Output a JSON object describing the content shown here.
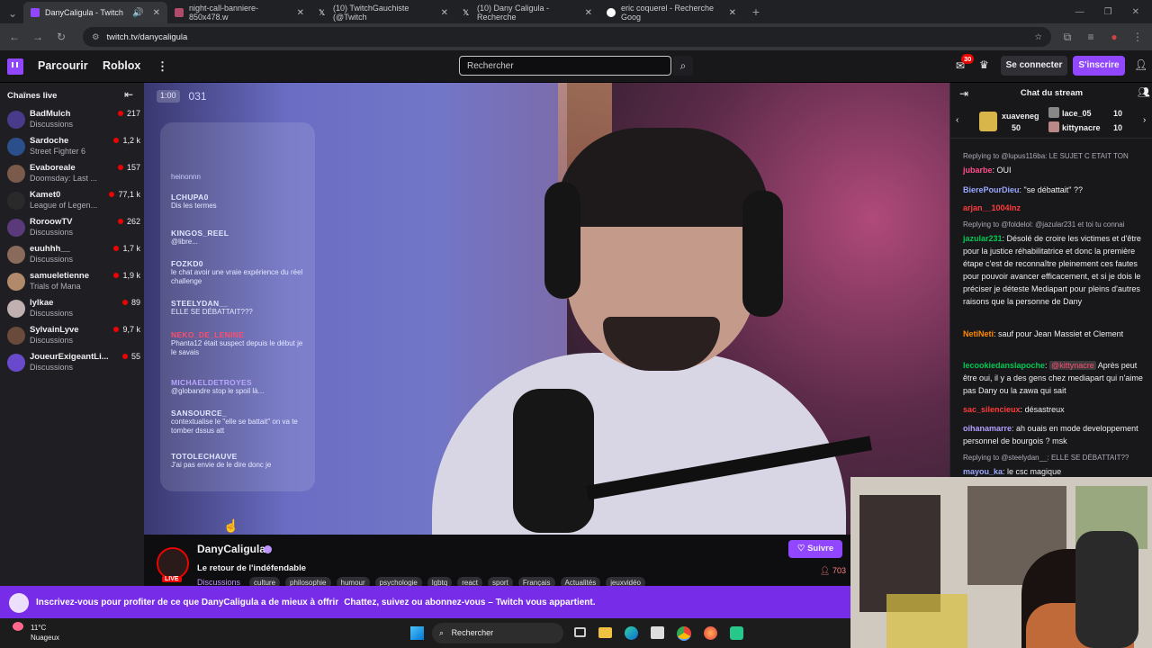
{
  "browser": {
    "tabs": [
      {
        "title": "DanyCaligula - Twitch",
        "active": true
      },
      {
        "title": "night-call-banniere-850x478.w"
      },
      {
        "title": "(10) TwitchGauchiste (@Twitch"
      },
      {
        "title": "(10) Dany Caligula - Recherche"
      },
      {
        "title": "eric coquerel - Recherche Goog"
      }
    ],
    "url": "twitch.tv/danycaligula"
  },
  "topnav": {
    "browse": "Parcourir",
    "roblox": "Roblox",
    "search_placeholder": "Rechercher",
    "notif_count": "30",
    "login": "Se connecter",
    "signup": "S'inscrire"
  },
  "sidebar": {
    "title": "Chaînes live",
    "channels": [
      {
        "name": "BadMulch",
        "category": "Discussions",
        "viewers": "217",
        "color": "#4a3a8a"
      },
      {
        "name": "Sardoche",
        "category": "Street Fighter 6",
        "viewers": "1,2 k",
        "color": "#2b4f8a"
      },
      {
        "name": "Evaboreale",
        "category": "Doomsday: Last ...",
        "viewers": "157",
        "color": "#7a5a4a"
      },
      {
        "name": "Kamet0",
        "category": "League of Legen...",
        "viewers": "77,1 k",
        "color": "#2a2a2a"
      },
      {
        "name": "RoroowTV",
        "category": "Discussions",
        "viewers": "262",
        "color": "#5a3a7a"
      },
      {
        "name": "euuhhh__",
        "category": "Discussions",
        "viewers": "1,7 k",
        "color": "#8a6a5a"
      },
      {
        "name": "samueletienne",
        "category": "Trials of Mana",
        "viewers": "1,9 k",
        "color": "#b08a6a"
      },
      {
        "name": "lylkae",
        "category": "Discussions",
        "viewers": "89",
        "color": "#c0b0b0"
      },
      {
        "name": "SylvainLyve",
        "category": "Discussions",
        "viewers": "9,7 k",
        "color": "#6a4a3a"
      },
      {
        "name": "JoueurExigeantLi...",
        "category": "Discussions",
        "viewers": "55",
        "color": "#6a4acc"
      }
    ]
  },
  "overlay_chat": [
    {
      "user": "LCHUPA0",
      "text": "Dis les termes",
      "color": "#dfe6ff"
    },
    {
      "user": "KINGOS_REEL",
      "text": "@libre...",
      "color": "#dfe6ff"
    },
    {
      "user": "FOZKD0",
      "text": "le chat avoir une vraie expérience du réel challenge",
      "color": "#dfe6ff"
    },
    {
      "user": "STEELYDAN__",
      "text": "ELLE SE DÉBATTAIT???",
      "color": "#dfe6ff"
    },
    {
      "user": "NEKO_DE_LENINE",
      "text": "Phanta12 était suspect depuis le début je le savais",
      "color": "#ff4d6d"
    },
    {
      "user": "MICHAELDETROYES",
      "text": "@globandre stop le spoil là...",
      "color": "#b8a6ff"
    },
    {
      "user": "SANSOURCE_",
      "text": "contextualise le \"elle se battait\" on va te tomber dssus att",
      "color": "#dfe6ff"
    },
    {
      "user": "TOTOLECHAUVE",
      "text": "J'ai pas envie de le dire donc je",
      "color": "#dfe6ff"
    }
  ],
  "overlay_badge": {
    "time": "1:00",
    "code": "031"
  },
  "chat": {
    "title": "Chat du stream",
    "gifters": [
      {
        "name": "xuaveneg",
        "count": "50"
      },
      {
        "name": "lace_05",
        "count": "10"
      },
      {
        "name": "kittynacre",
        "count": "10"
      }
    ],
    "messages": [
      {
        "reply": "Replying to @lupus116ba: LE SUJET C ETAIT TON",
        "user": "jubarbe",
        "color": "#ff4d8a",
        "text": "OUI"
      },
      {
        "user": "BierePourDieu",
        "color": "#9aa8ff",
        "text": "\"se débattait\" ??"
      },
      {
        "user": "arjan__1004lnz",
        "color": "#ff3b3b",
        "text": ""
      },
      {
        "reply": "Replying to @foldelol: @jazular231 et toi tu connai",
        "user": "jazular231",
        "color": "#00c853",
        "text": "Désolé de croire les victimes et d'être pour la justice réhabilitatrice et donc la première étape c'est de reconnaître pleinement ces fautes pour pouvoir avancer efficacement, et si je dois le préciser je déteste Mediapart pour pleins d'autres raisons que la personne de Dany"
      },
      {
        "user": "NetiNeti",
        "color": "#ff8a00",
        "text": "sauf pour Jean Massiet et Clement"
      },
      {
        "user": "lecookiedanslapoche",
        "color": "#00c853",
        "mention": "@kittynacre",
        "text": "Après peut être oui, il y a des gens chez mediapart qui n'aime pas Dany ou la zawa qui sait"
      },
      {
        "user": "sac_silencieux",
        "color": "#ff3b3b",
        "text": "désastreux"
      },
      {
        "user": "oihanamarre",
        "color": "#b4a0ff",
        "text": "ah ouais en mode developpement personnel de bourgois ? msk"
      },
      {
        "reply": "Replying to @steelydan__: ELLE SE DÉBATTAIT??",
        "user": "mayou_ka",
        "color": "#9aa8ff",
        "text": "le csc magique"
      }
    ]
  },
  "stream_info": {
    "channel": "DanyCaligula",
    "title": "Le retour de l'indéfendable",
    "live": "LIVE",
    "category": "Discussions",
    "tags": [
      "culture",
      "philosophie",
      "humour",
      "psychologie",
      "lgbtq",
      "react",
      "sport",
      "Français",
      "Actualités",
      "jeuxvidéo"
    ],
    "viewers": "703",
    "follow": "Suivre"
  },
  "banner": {
    "text1": "Inscrivez-vous pour profiter de ce que DanyCaligula a de mieux à offrir",
    "text2": "Chattez, suivez ou abonnez-vous – Twitch vous appartient."
  },
  "taskbar": {
    "temp": "11°C",
    "weather": "Nuageux",
    "search": "Rechercher"
  }
}
